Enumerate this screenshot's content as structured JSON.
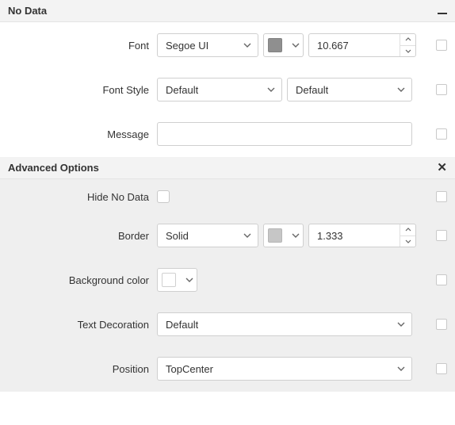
{
  "sections": {
    "noData": {
      "title": "No Data",
      "rows": {
        "font": {
          "label": "Font",
          "value": "Segoe UI",
          "size": "10.667"
        },
        "fontStyle": {
          "label": "Font Style",
          "left": "Default",
          "right": "Default"
        },
        "message": {
          "label": "Message",
          "value": ""
        }
      }
    },
    "advanced": {
      "title": "Advanced Options",
      "rows": {
        "hide": {
          "label": "Hide No Data"
        },
        "border": {
          "label": "Border",
          "style": "Solid",
          "width": "1.333"
        },
        "bg": {
          "label": "Background color"
        },
        "deco": {
          "label": "Text Decoration",
          "value": "Default"
        },
        "position": {
          "label": "Position",
          "value": "TopCenter"
        }
      }
    }
  }
}
